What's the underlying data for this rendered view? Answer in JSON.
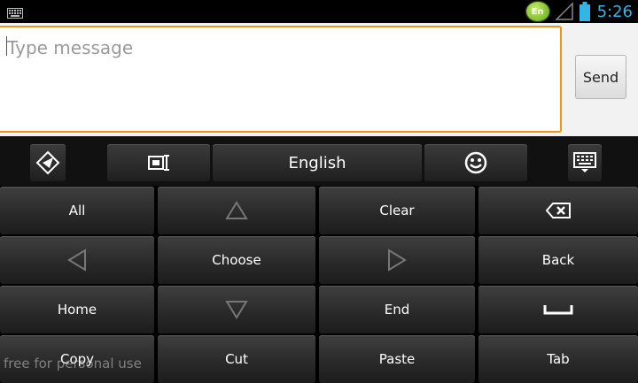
{
  "status_bar": {
    "keyboard_icon": "keyboard-notification-icon",
    "language_badge": "En",
    "signal_icon": "signal-icon",
    "battery_icon": "battery-icon",
    "time": "5:26",
    "accent_color": "#33b5e5"
  },
  "compose": {
    "placeholder": "Type message",
    "send_label": "Send",
    "focus_color": "#f0951a"
  },
  "toolbar": {
    "settings_icon": "settings-logo-icon",
    "layout_icon": "layout-switch-icon",
    "language_label": "English",
    "emoji_icon": "smiley-icon",
    "hide_keyboard_icon": "hide-keyboard-icon"
  },
  "keys": {
    "all": "All",
    "up": "up-arrow-icon",
    "clear": "Clear",
    "backspace": "backspace-icon",
    "left": "left-arrow-icon",
    "choose": "Choose",
    "right": "right-arrow-icon",
    "back": "Back",
    "home": "Home",
    "down": "down-arrow-icon",
    "end": "End",
    "space": "space-icon",
    "copy": "Copy",
    "cut": "Cut",
    "paste": "Paste",
    "tab": "Tab"
  },
  "watermark": "free for personal use"
}
